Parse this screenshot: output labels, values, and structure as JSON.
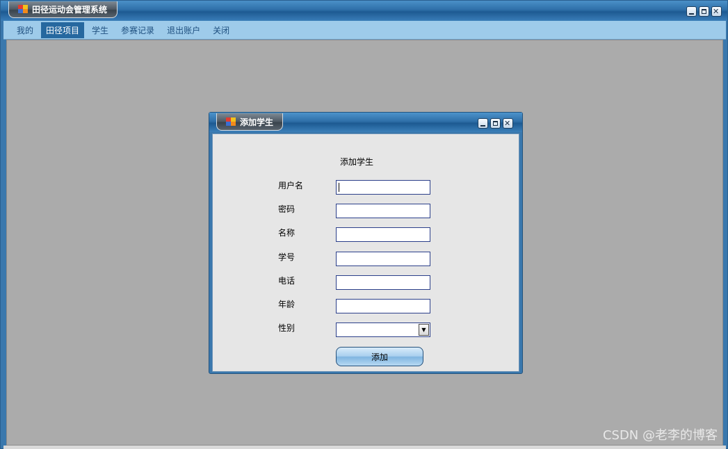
{
  "app": {
    "title": "田径运动会管理系统"
  },
  "menu": {
    "items": [
      {
        "label": "我的",
        "active": false
      },
      {
        "label": "田径项目",
        "active": true
      },
      {
        "label": "学生",
        "active": false
      },
      {
        "label": "参赛记录",
        "active": false
      },
      {
        "label": "退出账户",
        "active": false
      },
      {
        "label": "关闭",
        "active": false
      }
    ]
  },
  "dialog": {
    "title": "添加学生",
    "heading": "添加学生",
    "fields": [
      {
        "label": "用户名",
        "value": ""
      },
      {
        "label": "密码",
        "value": ""
      },
      {
        "label": "名称",
        "value": ""
      },
      {
        "label": "学号",
        "value": ""
      },
      {
        "label": "电话",
        "value": ""
      },
      {
        "label": "年龄",
        "value": ""
      }
    ],
    "gender": {
      "label": "性别",
      "selected": ""
    },
    "submit_label": "添加"
  },
  "watermark": "CSDN @老李的博客",
  "colors": {
    "titlebar": "#2f6fa8",
    "menubar": "#9ecbea",
    "menu_active": "#26689f",
    "client_bg": "#ababab",
    "dialog_body": "#e6e6e6",
    "input_border": "#2b3f8a"
  },
  "icons": {
    "app": "app-logo-icon",
    "minimize": "minimize-icon",
    "maximize": "maximize-icon",
    "close": "close-icon",
    "dropdown": "chevron-down-icon"
  }
}
